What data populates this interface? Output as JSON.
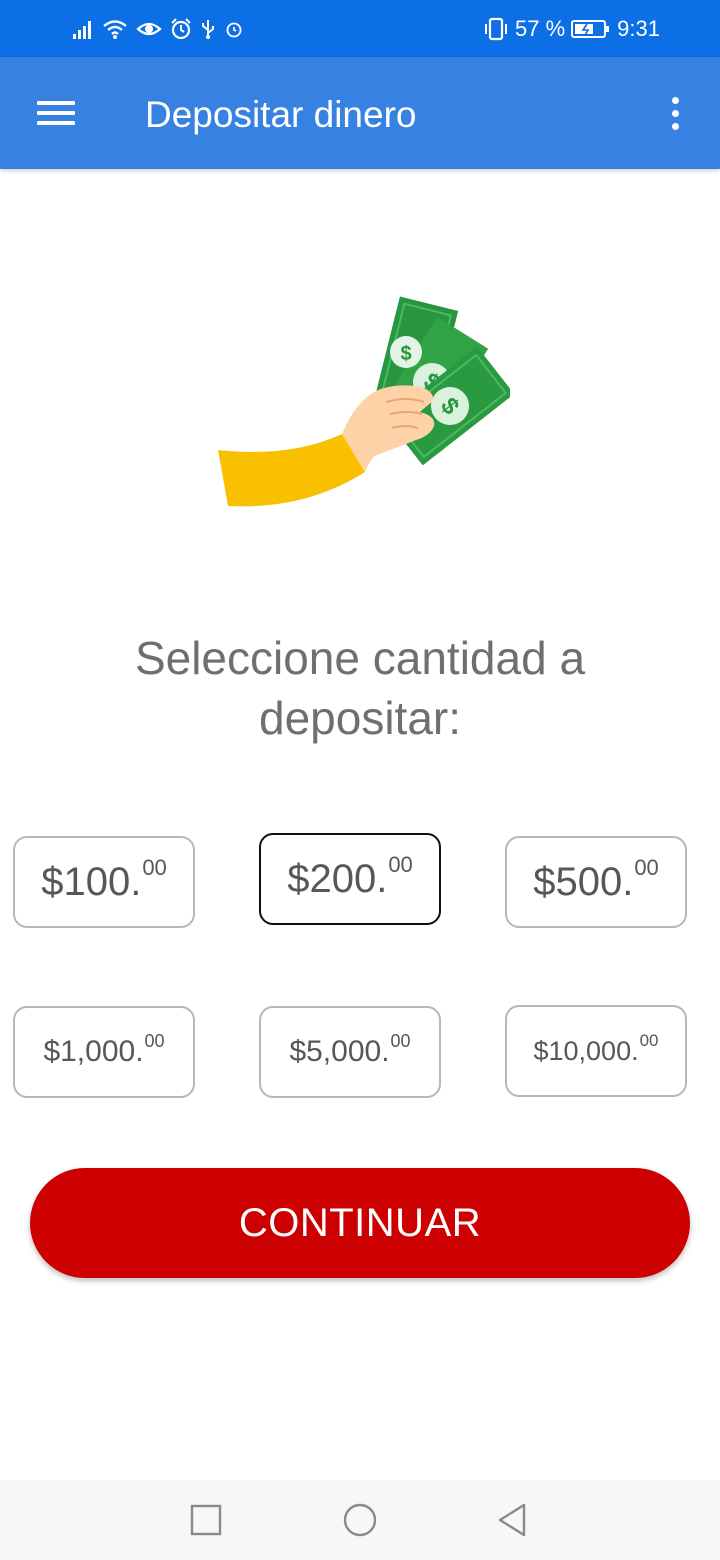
{
  "status_bar": {
    "battery": "57 %",
    "time": "9:31"
  },
  "app_bar": {
    "title": "Depositar dinero"
  },
  "illustration": {
    "icon": "hand-holding-money-icon"
  },
  "prompt": {
    "text": "Seleccione cantidad a depositar:"
  },
  "amounts": [
    {
      "main": "$100.",
      "cents": "00"
    },
    {
      "main": "$200.",
      "cents": "00",
      "selected": true
    },
    {
      "main": "$500.",
      "cents": "00"
    },
    {
      "main": "$1,000.",
      "cents": "00"
    },
    {
      "main": "$5,000.",
      "cents": "00"
    },
    {
      "main": "$10,000.",
      "cents": "00"
    }
  ],
  "continue_button": {
    "label": "CONTINUAR"
  },
  "colors": {
    "status_bar": "#0c6fe5",
    "app_bar": "#3781e2",
    "continue": "#cc0000",
    "money": "#2f9e44",
    "sleeve": "#f9c000",
    "skin": "#fcd2a6"
  }
}
